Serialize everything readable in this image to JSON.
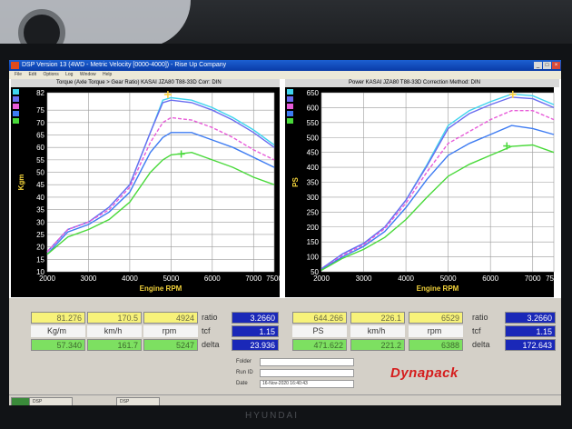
{
  "window": {
    "title": "DSP Version 13 (4WD - Metric Velocity [0000-4000]) - Rise Up Company"
  },
  "menu": [
    "File",
    "Edit",
    "Options",
    "Log",
    "Window",
    "Help"
  ],
  "left_chart": {
    "header": "Torque (Axle Torque > Gear Ratio)  KASAI JZA80 T88-33D   Corr: DIN",
    "ylabel": "Kgm",
    "xlabel": "Engine RPM",
    "y_ticks": [
      "82",
      "75",
      "70",
      "65",
      "60",
      "55",
      "50",
      "45",
      "40",
      "35",
      "30",
      "25",
      "20",
      "15",
      "10"
    ],
    "x_ticks": [
      "2000",
      "3000",
      "4000",
      "5000",
      "6000",
      "7000",
      "7500"
    ]
  },
  "right_chart": {
    "header": "Power  KASAI JZA80 T88-33D   Correction Method: DIN",
    "ylabel": "PS",
    "xlabel": "Engine RPM",
    "y_ticks": [
      "650",
      "600",
      "550",
      "500",
      "450",
      "400",
      "350",
      "300",
      "250",
      "200",
      "150",
      "100",
      "50"
    ],
    "x_ticks": [
      "2000",
      "3000",
      "4000",
      "5000",
      "6000",
      "7000",
      "7500"
    ]
  },
  "chart_data": [
    {
      "type": "line",
      "ylabel": "Kgm",
      "xlabel": "Engine RPM",
      "xlim": [
        2000,
        7500
      ],
      "ylim": [
        10,
        82
      ],
      "series": [
        {
          "color": "#3fd4ee",
          "x": [
            2000,
            2500,
            3000,
            3500,
            4000,
            4500,
            4800,
            5000,
            5500,
            6000,
            6500,
            7000,
            7500
          ],
          "y": [
            18,
            27,
            30,
            36,
            45,
            66,
            79,
            80,
            79,
            76,
            72,
            67,
            61
          ]
        },
        {
          "color": "#6a6cf0",
          "x": [
            2000,
            2500,
            3000,
            3500,
            4000,
            4500,
            4800,
            5000,
            5500,
            6000,
            6500,
            7000,
            7500
          ],
          "y": [
            18,
            27,
            30,
            36,
            45,
            66,
            78,
            79,
            78,
            75,
            71,
            66,
            60
          ]
        },
        {
          "color": "#e85cd9",
          "x": [
            2000,
            2500,
            3000,
            3500,
            4000,
            4500,
            4800,
            5000,
            5500,
            6000,
            6500,
            7000,
            7500
          ],
          "y": [
            18,
            27,
            30,
            35,
            44,
            62,
            70,
            72,
            71,
            68,
            64,
            59,
            55
          ]
        },
        {
          "color": "#3d7bf2",
          "x": [
            2000,
            2500,
            3000,
            3500,
            4000,
            4500,
            4800,
            5000,
            5500,
            6000,
            6500,
            7000,
            7500
          ],
          "y": [
            17,
            26,
            29,
            34,
            42,
            58,
            64,
            66,
            66,
            63,
            60,
            56,
            52
          ]
        },
        {
          "color": "#49d93a",
          "x": [
            2000,
            2500,
            3000,
            3500,
            4000,
            4500,
            4800,
            5000,
            5500,
            6000,
            6500,
            7000,
            7500
          ],
          "y": [
            17,
            24,
            27,
            31,
            38,
            50,
            55,
            57,
            58,
            55,
            52,
            48,
            45
          ]
        }
      ],
      "markers": [
        {
          "x": 4924,
          "y": 81.276,
          "color": "#ffd23a"
        },
        {
          "x": 5247,
          "y": 57.34,
          "color": "#49d93a"
        }
      ]
    },
    {
      "type": "line",
      "ylabel": "PS",
      "xlabel": "Engine RPM",
      "xlim": [
        2000,
        7500
      ],
      "ylim": [
        50,
        650
      ],
      "series": [
        {
          "color": "#3fd4ee",
          "x": [
            2000,
            2500,
            3000,
            3500,
            4000,
            4500,
            5000,
            5500,
            6000,
            6500,
            7000,
            7500
          ],
          "y": [
            60,
            110,
            145,
            200,
            290,
            410,
            540,
            590,
            620,
            645,
            640,
            610
          ]
        },
        {
          "color": "#6a6cf0",
          "x": [
            2000,
            2500,
            3000,
            3500,
            4000,
            4500,
            5000,
            5500,
            6000,
            6500,
            7000,
            7500
          ],
          "y": [
            60,
            110,
            145,
            200,
            290,
            405,
            530,
            580,
            610,
            635,
            630,
            600
          ]
        },
        {
          "color": "#e85cd9",
          "x": [
            2000,
            2500,
            3000,
            3500,
            4000,
            4500,
            5000,
            5500,
            6000,
            6500,
            7000,
            7500
          ],
          "y": [
            58,
            105,
            140,
            195,
            280,
            385,
            480,
            520,
            560,
            590,
            590,
            560
          ]
        },
        {
          "color": "#3d7bf2",
          "x": [
            2000,
            2500,
            3000,
            3500,
            4000,
            4500,
            5000,
            5500,
            6000,
            6500,
            7000,
            7500
          ],
          "y": [
            57,
            100,
            135,
            185,
            265,
            360,
            440,
            480,
            510,
            540,
            530,
            510
          ]
        },
        {
          "color": "#49d93a",
          "x": [
            2000,
            2500,
            3000,
            3500,
            4000,
            4500,
            5000,
            5500,
            6000,
            6500,
            7000,
            7500
          ],
          "y": [
            55,
            95,
            125,
            165,
            225,
            300,
            370,
            410,
            440,
            470,
            475,
            450
          ]
        }
      ],
      "markers": [
        {
          "x": 6529,
          "y": 644.266,
          "color": "#ffd23a"
        },
        {
          "x": 6388,
          "y": 471.622,
          "color": "#49d93a"
        }
      ]
    }
  ],
  "left_table": {
    "row1": [
      "81.276",
      "170.5",
      "4924"
    ],
    "units": [
      "Kg/m",
      "km/h",
      "rpm"
    ],
    "row2": [
      "57.340",
      "161.7",
      "5247"
    ],
    "ratio_label": "ratio",
    "ratio": "3.2660",
    "tcf_label": "tcf",
    "tcf": "1.15",
    "delta_label": "delta",
    "delta": "23.936"
  },
  "right_table": {
    "row1": [
      "644.266",
      "226.1",
      "6529"
    ],
    "units": [
      "PS",
      "km/h",
      "rpm"
    ],
    "row2": [
      "471.622",
      "221.2",
      "6388"
    ],
    "ratio_label": "ratio",
    "ratio": "3.2660",
    "tcf_label": "tcf",
    "tcf": "1.15",
    "delta_label": "delta",
    "delta": "172.643"
  },
  "info": {
    "folder_label": "Folder",
    "run_label": "Run ID",
    "date_label": "Date",
    "date_value": "16-Nov-2020 16:40:43"
  },
  "logo": "Dynapack",
  "taskbar": {
    "start": "",
    "tasks": [
      "DSP",
      "DSP"
    ],
    "clock": ""
  },
  "monitor_brand": "HYUNDAI",
  "colors": {
    "yellow_cell": "#f7f27a",
    "green_cell": "#7de061",
    "blue_cell": "#1a28b8",
    "logo": "#d51c1c"
  }
}
